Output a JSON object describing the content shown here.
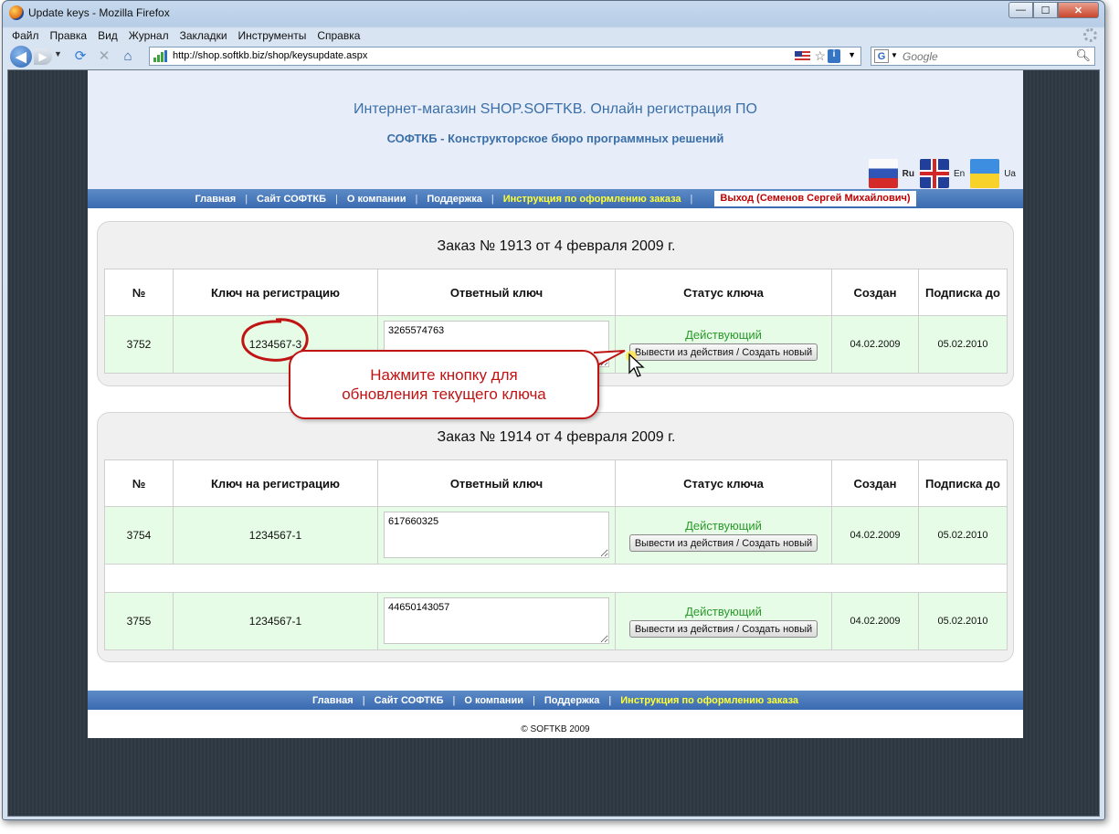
{
  "window": {
    "title": "Update keys - Mozilla Firefox",
    "controls": {
      "minimize": "0",
      "maximize": "1",
      "close": "r"
    }
  },
  "menu": [
    "Файл",
    "Правка",
    "Вид",
    "Журнал",
    "Закладки",
    "Инструменты",
    "Справка"
  ],
  "browser": {
    "url": "http://shop.softkb.biz/shop/keysupdate.aspx",
    "search_placeholder": "Google"
  },
  "header": {
    "title": "Интернет-магазин SHOP.SOFTKB. Онлайн регистрация ПО",
    "subtitle": "СОФТКБ - Конструкторское бюро программных решений",
    "languages": [
      {
        "code": "Ru",
        "flag": "russia-flag-icon"
      },
      {
        "code": "En",
        "flag": "uk-flag-icon"
      },
      {
        "code": "Ua",
        "flag": "ukraine-flag-icon"
      }
    ]
  },
  "nav": {
    "items": [
      "Главная",
      "Сайт СОФТКБ",
      "О компании",
      "Поддержка",
      "Инструкция по оформлению заказа"
    ],
    "separator": "|",
    "logout": "Выход (Семенов Сергей Михайлович)"
  },
  "table_headers": [
    "№",
    "Ключ на регистрацию",
    "Ответный ключ",
    "Статус ключа",
    "Создан",
    "Подписка до"
  ],
  "orders": [
    {
      "title": "Заказ № 1913 от 4 февраля 2009 г.",
      "rows": [
        {
          "num": "3752",
          "key": "1234567-3",
          "response": "3265574763",
          "status": "Действующий",
          "button": "Вывести из действия / Создать новый",
          "created": "04.02.2009",
          "until": "05.02.2010"
        }
      ]
    },
    {
      "title": "Заказ № 1914 от 4 февраля 2009 г.",
      "rows": [
        {
          "num": "3754",
          "key": "1234567-1",
          "response": "617660325",
          "status": "Действующий",
          "button": "Вывести из действия / Создать новый",
          "created": "04.02.2009",
          "until": "05.02.2010"
        },
        {
          "num": "3755",
          "key": "1234567-1",
          "response": "44650143057",
          "status": "Действующий",
          "button": "Вывести из действия / Создать новый",
          "created": "04.02.2009",
          "until": "05.02.2010"
        }
      ]
    }
  ],
  "callout": {
    "line1": "Нажмите кнопку для",
    "line2": "обновления текущего ключа"
  },
  "footer": {
    "items": [
      "Главная",
      "Сайт СОФТКБ",
      "О компании",
      "Поддержка",
      "Инструкция по оформлению заказа"
    ],
    "copyright": "© SOFTKB 2009"
  },
  "colors": {
    "nav_bar": "#3a6bb0",
    "header_bg": "#e7eefa",
    "title_blue": "#3b6fa8",
    "highlight_yellow": "#ffff33",
    "logout_red": "#c00000",
    "row_green": "#e6fce6",
    "status_green": "#2a9a2a",
    "annotation_red": "#c01414"
  }
}
